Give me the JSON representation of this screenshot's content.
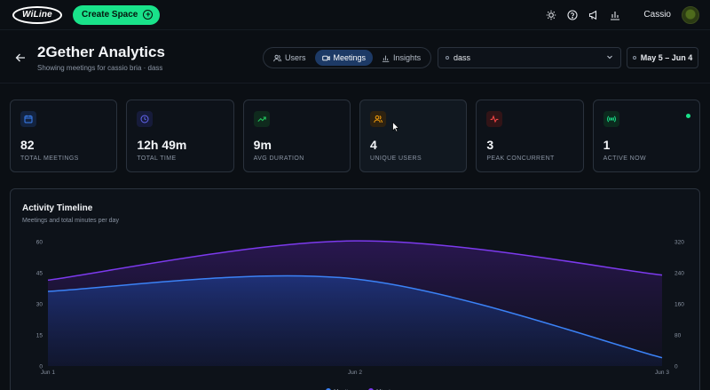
{
  "topbar": {
    "logo_text": "WiLine",
    "create_button_label": "Create Space",
    "user_name": "Cassio",
    "icons": [
      "sun-icon",
      "help-icon",
      "megaphone-icon",
      "bar-chart-icon"
    ]
  },
  "header": {
    "title": "2Gether Analytics",
    "subtitle": "Showing meetings for cassio bria · dass",
    "tabs": [
      {
        "label": "Users",
        "icon": "users-icon",
        "active": false
      },
      {
        "label": "Meetings",
        "icon": "video-icon",
        "active": true
      },
      {
        "label": "Insights",
        "icon": "chart-icon",
        "active": false
      }
    ],
    "space_select_value": "dass",
    "date_range": "May 5 – Jun 4"
  },
  "stats": [
    {
      "value": "82",
      "label": "TOTAL MEETINGS",
      "icon": "calendar-icon",
      "color": "#3b82f6"
    },
    {
      "value": "12h 49m",
      "label": "TOTAL TIME",
      "icon": "clock-icon",
      "color": "#6366f1"
    },
    {
      "value": "9m",
      "label": "AVG DURATION",
      "icon": "trending-up-icon",
      "color": "#22c55e"
    },
    {
      "value": "4",
      "label": "UNIQUE USERS",
      "icon": "users-icon",
      "color": "#f59e0b"
    },
    {
      "value": "3",
      "label": "PEAK CONCURRENT",
      "icon": "activity-icon",
      "color": "#ef4444"
    },
    {
      "value": "1",
      "label": "ACTIVE NOW",
      "icon": "broadcast-icon",
      "color": "#19e28a"
    }
  ],
  "chart": {
    "title": "Activity Timeline",
    "subtitle": "Meetings and total minutes per day"
  },
  "chart_data": {
    "type": "area",
    "x": [
      "Jun 1",
      "Jun 2",
      "Jun 3"
    ],
    "y_left_ticks": [
      0,
      15,
      30,
      45,
      60
    ],
    "y_right_ticks": [
      0,
      80,
      160,
      240,
      320
    ],
    "ylim_left": [
      0,
      60
    ],
    "ylim_right": [
      0,
      320
    ],
    "series": [
      {
        "name": "Meetings",
        "axis": "left",
        "color": "#3b82f6",
        "values": [
          36,
          42,
          4
        ]
      },
      {
        "name": "Minutes",
        "axis": "right",
        "color": "#7c3aed",
        "values": [
          221,
          322,
          234
        ]
      }
    ],
    "grid": false,
    "legend": "bottom"
  }
}
